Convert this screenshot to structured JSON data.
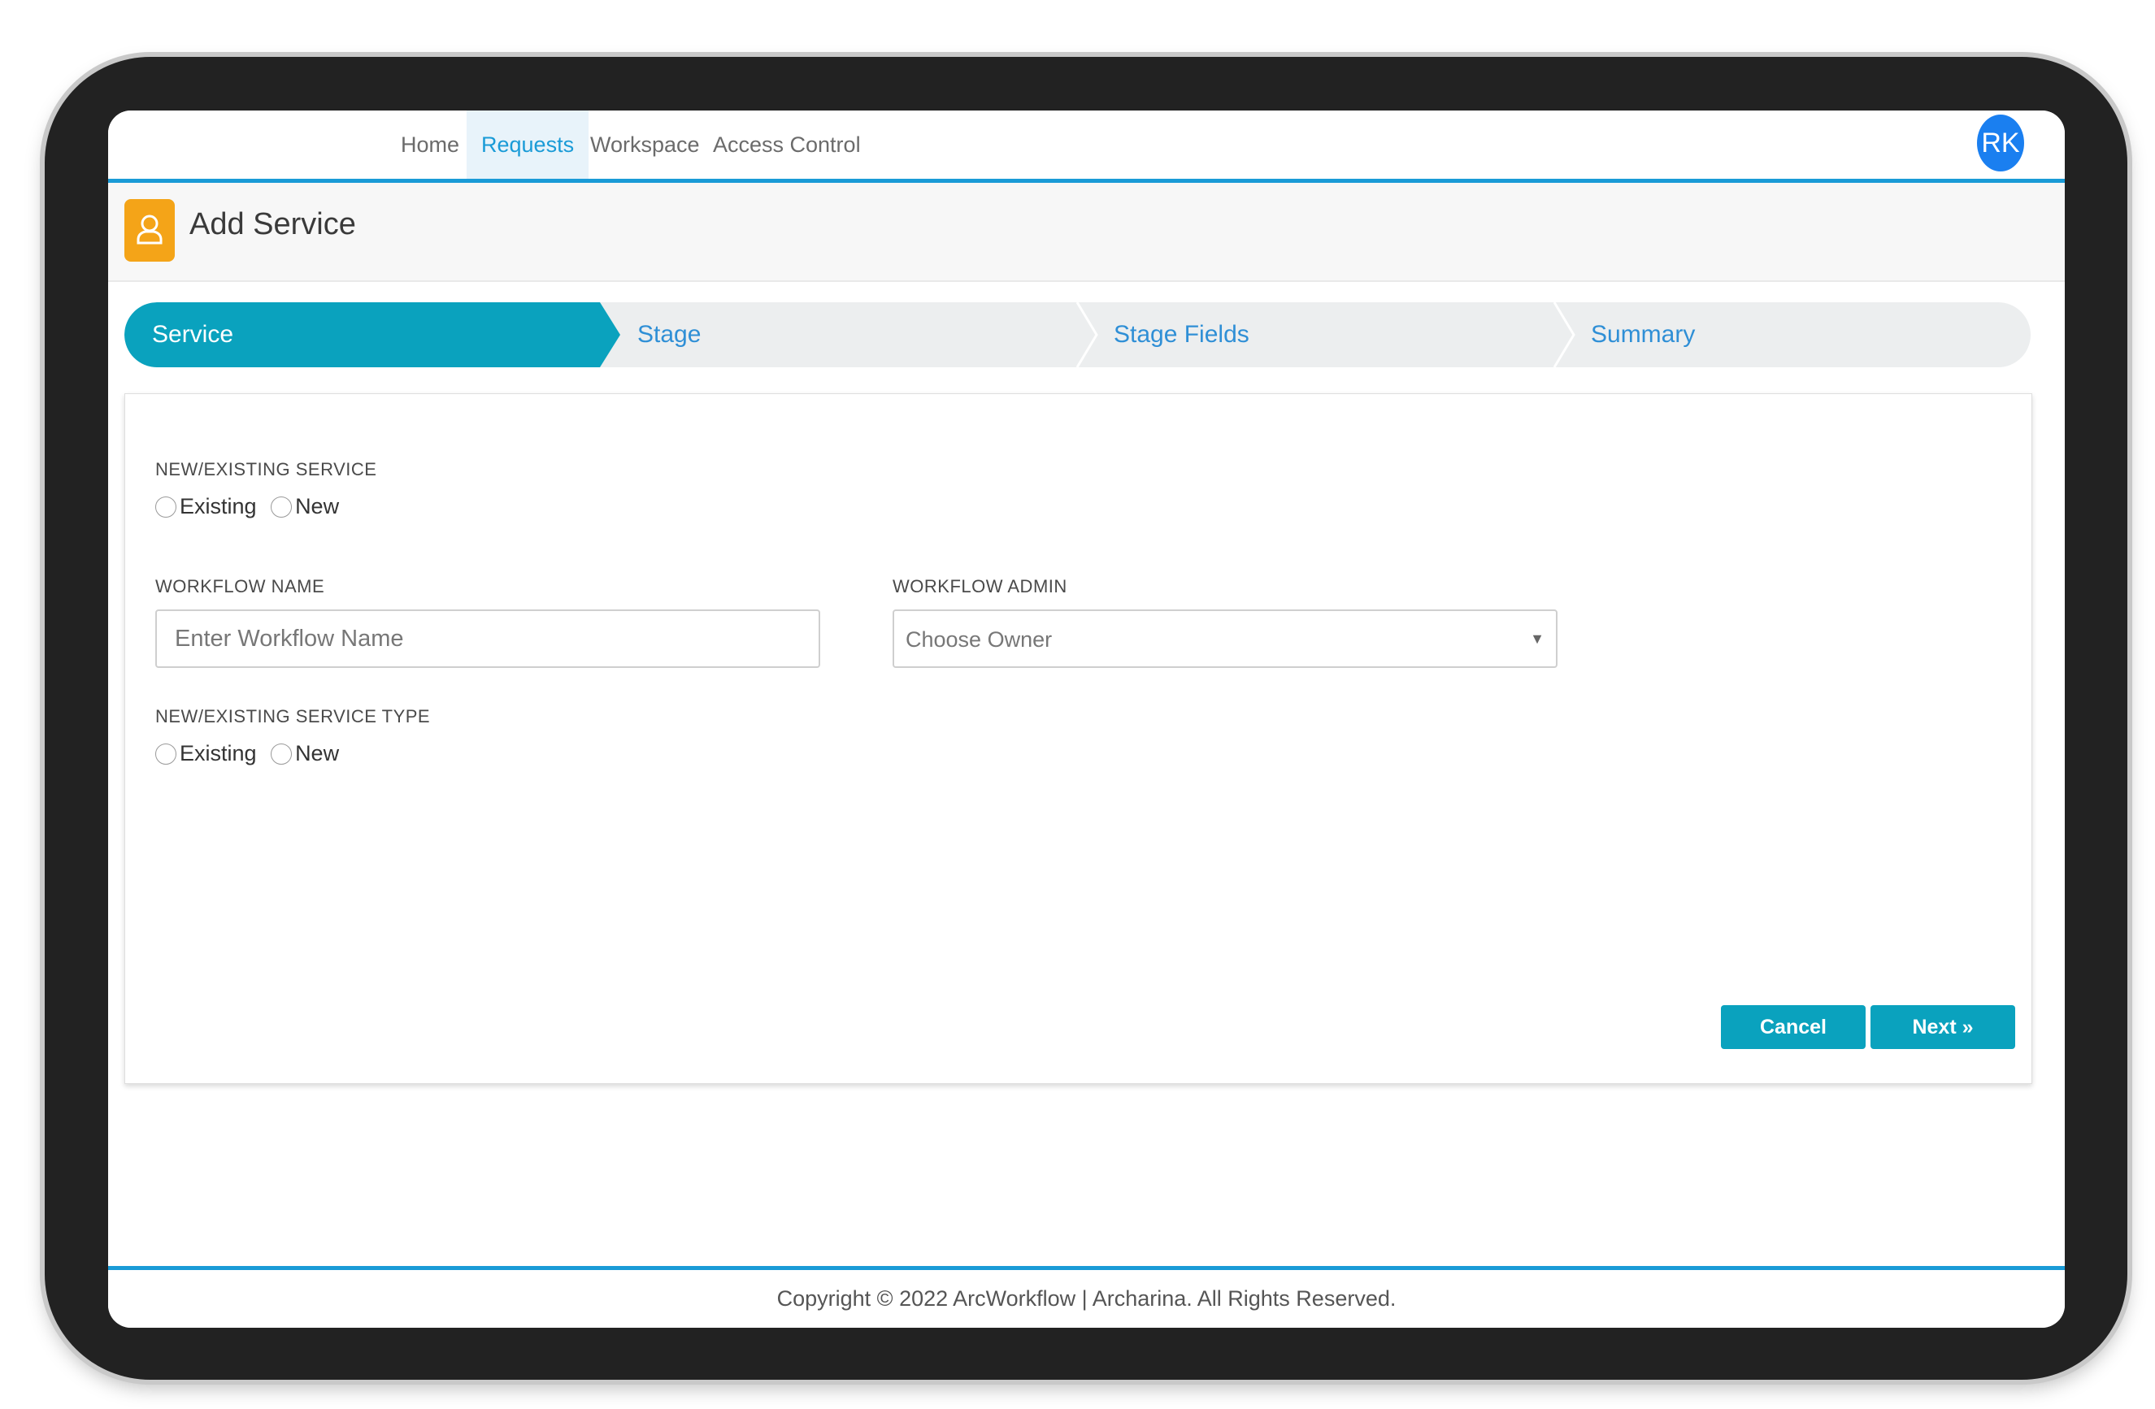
{
  "nav": {
    "items": [
      {
        "label": "Home"
      },
      {
        "label": "Requests"
      },
      {
        "label": "Workspace"
      },
      {
        "label": "Access Control"
      }
    ],
    "active": "Requests",
    "avatar_initials": "RK"
  },
  "header": {
    "title": "Add Service",
    "icon": "user-icon"
  },
  "stepper": {
    "steps": [
      {
        "label": "Service"
      },
      {
        "label": "Stage"
      },
      {
        "label": "Stage Fields"
      },
      {
        "label": "Summary"
      }
    ],
    "active": "Service"
  },
  "form": {
    "service_choice": {
      "label": "NEW/EXISTING SERVICE",
      "options": [
        "Existing",
        "New"
      ]
    },
    "workflow_name": {
      "label": "WORKFLOW NAME",
      "placeholder": "Enter Workflow Name",
      "value": ""
    },
    "workflow_admin": {
      "label": "WORKFLOW ADMIN",
      "selected": "Choose Owner"
    },
    "service_type_choice": {
      "label": "NEW/EXISTING SERVICE TYPE",
      "options": [
        "Existing",
        "New"
      ]
    },
    "cancel_label": "Cancel",
    "next_label": "Next »"
  },
  "footer": {
    "text": "Copyright © 2022 ArcWorkflow | Archarina. All Rights Reserved."
  },
  "colors": {
    "accent": "#0aa2be",
    "nav_border": "#1a9bd7",
    "header_icon": "#f4a418",
    "avatar": "#1a7ff0"
  }
}
